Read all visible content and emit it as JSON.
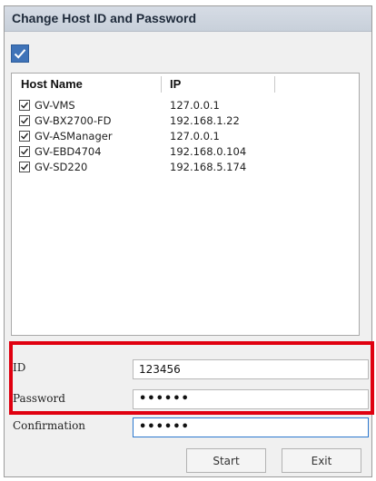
{
  "window": {
    "title": "Change Host ID and Password"
  },
  "select_all": {
    "checked": true
  },
  "hosts": {
    "columns": [
      "Host Name",
      "IP"
    ],
    "rows": [
      {
        "name": "GV-VMS",
        "ip": "127.0.0.1",
        "checked": true
      },
      {
        "name": "GV-BX2700-FD",
        "ip": "192.168.1.22",
        "checked": true
      },
      {
        "name": "GV-ASManager",
        "ip": "127.0.0.1",
        "checked": true
      },
      {
        "name": "GV-EBD4704",
        "ip": "192.168.0.104",
        "checked": true
      },
      {
        "name": "GV-SD220",
        "ip": "192.168.5.174",
        "checked": true
      }
    ]
  },
  "form": {
    "id_label": "ID",
    "id_value": "123456",
    "password_label": "Password",
    "password_value": "••••••",
    "confirmation_label": "Confirmation",
    "confirmation_value": "••••••"
  },
  "buttons": {
    "start": "Start",
    "exit": "Exit"
  },
  "colors": {
    "highlight_border": "#e00010",
    "checkbox_fill": "#3f73b8"
  }
}
